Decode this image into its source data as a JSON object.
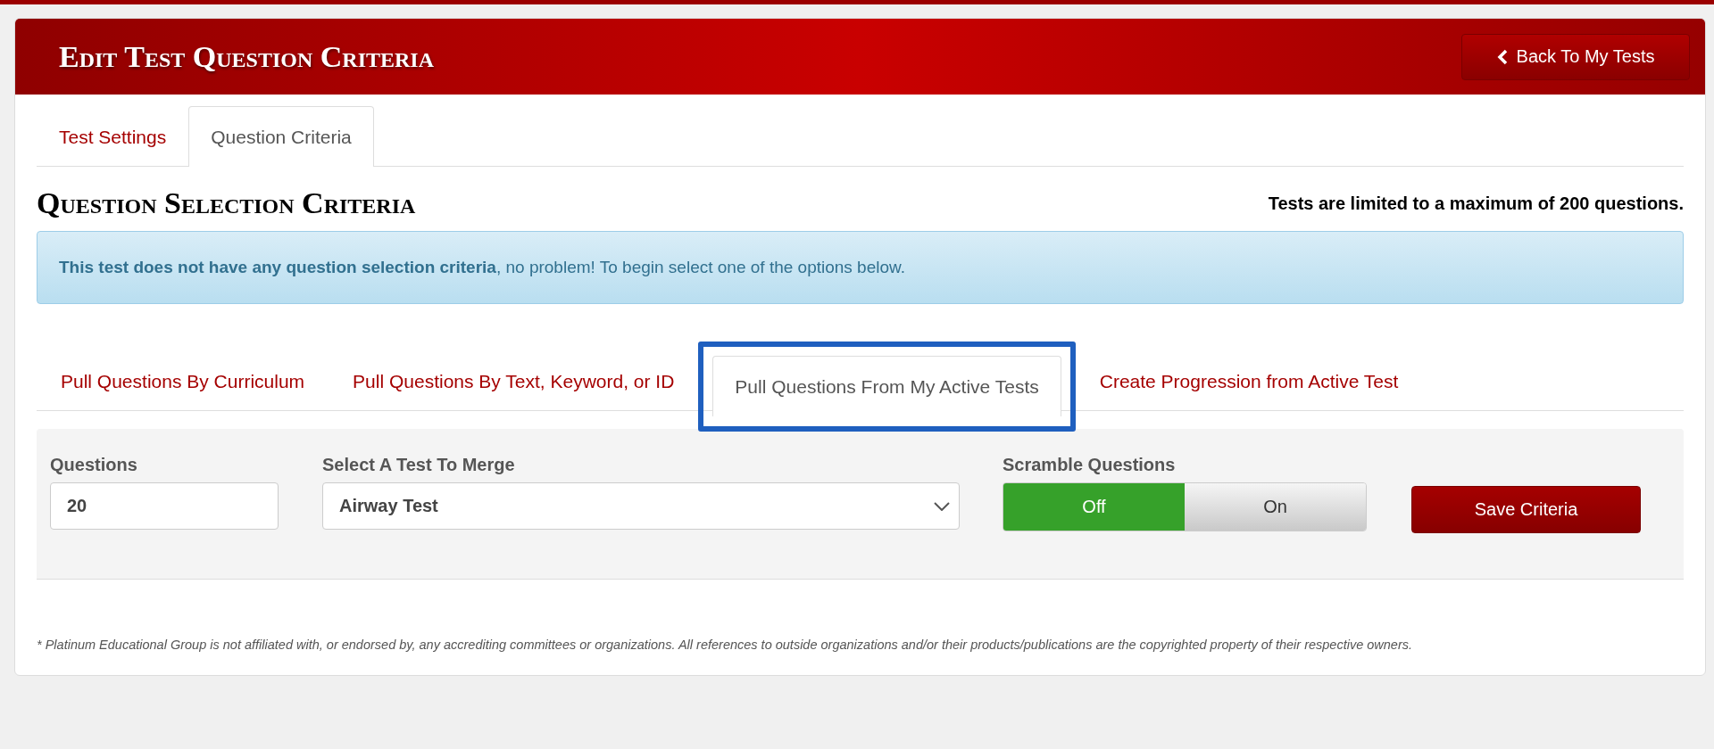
{
  "header": {
    "title": "Edit Test Question Criteria",
    "back_button": "Back To My Tests"
  },
  "tabs": [
    {
      "label": "Test Settings",
      "selected": false
    },
    {
      "label": "Question Criteria",
      "selected": true
    }
  ],
  "section": {
    "title": "Question Selection Criteria",
    "limit_note": "Tests are limited to a maximum of 200 questions."
  },
  "alert": "**This test does not have any question selection criteria**, no problem! To begin select one of the options below.",
  "criteria_tabs": [
    {
      "label": "Pull Questions By Curriculum",
      "selected": false,
      "highlighted": false
    },
    {
      "label": "Pull Questions By Text, Keyword, or ID",
      "selected": false,
      "highlighted": false
    },
    {
      "label": "Pull Questions From My Active Tests",
      "selected": true,
      "highlighted": true
    },
    {
      "label": "Create Progression from Active Test",
      "selected": false,
      "highlighted": false
    }
  ],
  "form": {
    "questions_label": "Questions",
    "questions_value": "20",
    "test_label": "Select A Test To Merge",
    "test_value": "Airway Test",
    "scramble_label": "Scramble Questions",
    "scramble_options": [
      {
        "label": "Off",
        "selected": true
      },
      {
        "label": "On",
        "selected": false
      }
    ],
    "save_button": "Save Criteria"
  },
  "footer": "* Platinum Educational Group is not affiliated with, or endorsed by, any accrediting committees or organizations. All references to outside organizations and/or their products/publications are the copyrighted property of their respective owners."
}
